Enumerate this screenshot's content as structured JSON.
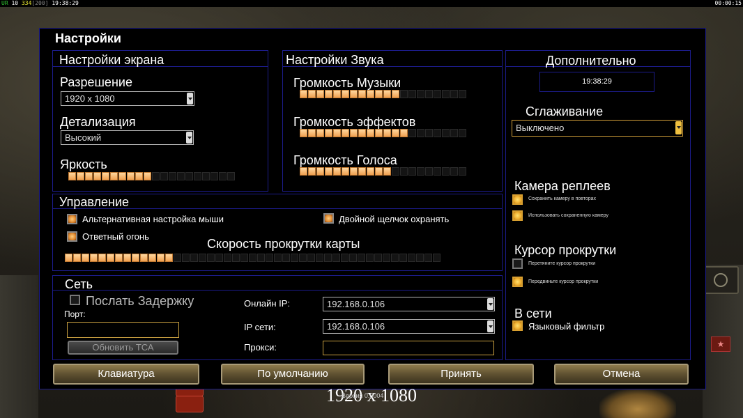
{
  "topbar": {
    "left_prefix": "UR",
    "money": "10",
    "power": "334",
    "power_max": "[200]",
    "time": "19:38:29",
    "right_time": "00:00:15"
  },
  "dialog": {
    "title": "Настройки"
  },
  "screen": {
    "header": "Настройки экрана",
    "resolution_label": "Разрешение",
    "resolution_value": "1920 x 1080",
    "detail_label": "Детализация",
    "detail_value": "Высокий",
    "brightness_label": "Яркость",
    "brightness_level": 10,
    "brightness_max": 20
  },
  "sound": {
    "header": "Настройки Звука",
    "music_label": "Громкость Музыки",
    "music_level": 12,
    "effects_label": "Громкость эффектов",
    "effects_level": 13,
    "voice_label": "Громкость Голоса",
    "voice_level": 11,
    "max": 20
  },
  "extra": {
    "header": "Дополнительно",
    "clock": "19:38:29",
    "antialias_label": "Сглаживание",
    "antialias_value": "Выключено",
    "replay_camera_label": "Камера реплеев",
    "replay_save": "Сохранить камеру в повторах",
    "replay_use": "Использовать сохраненную камеру",
    "scroll_cursor_label": "Курсор прокрутки",
    "scroll_cursor_opt1": "Перетяните курсор прокрутки",
    "scroll_cursor_opt2": "Передвиньте курсор прокрутки",
    "online_label": "В сети",
    "lang_filter": "Языковый фильтр"
  },
  "control": {
    "header": "Управление",
    "alt_mouse": "Альтернативная настройка мыши",
    "double_click": "Двойной щелчок охранять",
    "return_fire": "Ответный огонь",
    "scroll_speed_label": "Скорость прокрутки карты",
    "scroll_level": 13,
    "scroll_max": 45
  },
  "network": {
    "header": "Сеть",
    "send_delay": "Послать Задержку",
    "port_label": "Порт:",
    "port_value": "",
    "refresh_button": "Обновить ТСА",
    "online_ip_label": "Онлайн IP:",
    "online_ip_value": "192.168.0.106",
    "lan_ip_label": "IP сети:",
    "lan_ip_value": "192.168.0.106",
    "proxy_label": "Прокси:",
    "proxy_value": ""
  },
  "buttons": {
    "keyboard": "Клавиатура",
    "defaults": "По умолчанию",
    "accept": "Принять",
    "cancel": "Отмена"
  },
  "footer": {
    "resolution": "1920 x 1080",
    "version": "Версия 0.0004"
  }
}
